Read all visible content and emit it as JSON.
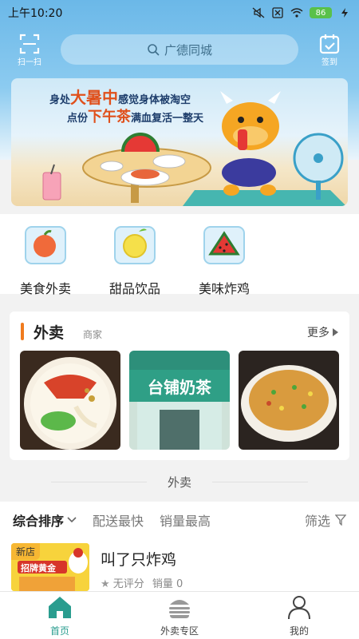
{
  "status": {
    "time": "上午10:20",
    "battery": "86"
  },
  "header": {
    "scan_label": "扫一扫",
    "search_placeholder": "广德同城",
    "signin_label": "签到"
  },
  "banner": {
    "line1_pre": "身处",
    "line1_big": "大暑中",
    "line1_post": "感觉身体被淘空",
    "line2_pre": "点份",
    "line2_big": "下午茶",
    "line2_post": "满血复活一整天"
  },
  "categories": [
    {
      "label": "美食外卖",
      "icon": "apple-ice-cube-icon"
    },
    {
      "label": "甜品饮品",
      "icon": "lemon-ice-cube-icon"
    },
    {
      "label": "美味炸鸡",
      "icon": "watermelon-ice-cube-icon"
    }
  ],
  "waimai_card": {
    "title": "外卖",
    "subtitle": "商家",
    "more": "更多",
    "thumbs": [
      "noodle-bowl",
      "taiwanese-milk-tea-shop",
      "fried-rice"
    ],
    "shop_sign": "台铺奶茶"
  },
  "section_divider": "外卖",
  "sort": {
    "items": [
      "综合排序",
      "配送最快",
      "销量最高"
    ],
    "filter": "筛选"
  },
  "shop": {
    "tag": "新店",
    "name": "叫了只炸鸡",
    "rating": "无评分",
    "sales": "销量 0",
    "promo_text": "招牌黄金"
  },
  "bottom_nav": [
    {
      "label": "首页",
      "icon": "home-icon",
      "active": true
    },
    {
      "label": "外卖专区",
      "icon": "burger-icon",
      "active": false
    },
    {
      "label": "我的",
      "icon": "user-icon",
      "active": false
    }
  ],
  "colors": {
    "header_blue": "#6bb8e8",
    "accent_orange": "#f07b1e",
    "active_teal": "#2a9d8f"
  }
}
